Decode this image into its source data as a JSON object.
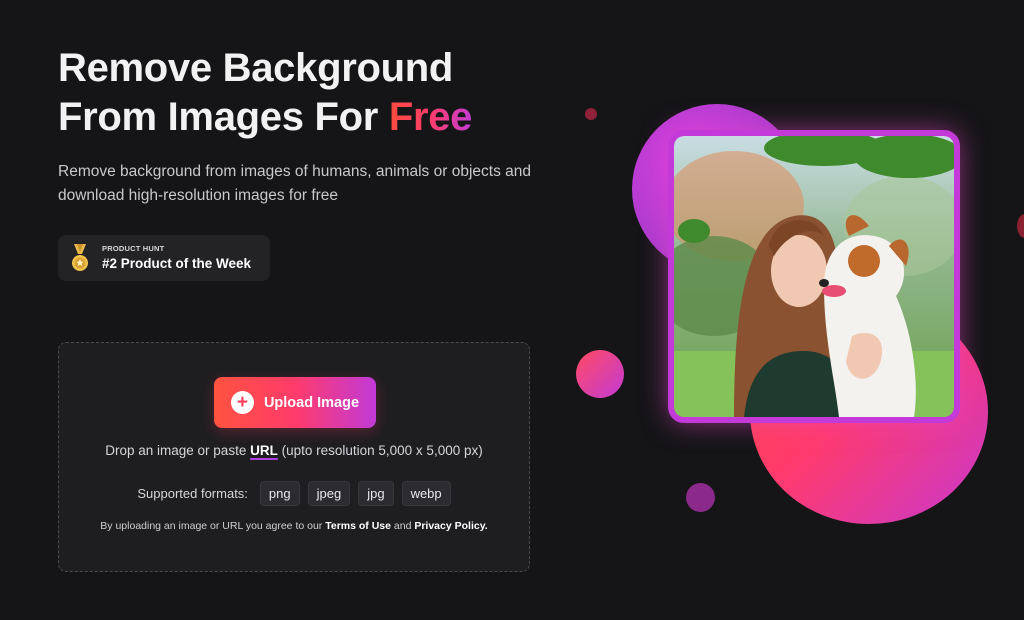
{
  "hero": {
    "title_line1": "Remove Background",
    "title_line2_prefix": "From Images For ",
    "title_highlight": "Free",
    "subtitle": "Remove background from images of humans, animals or objects and download high-resolution images for free"
  },
  "badge": {
    "small_label": "PRODUCT HUNT",
    "main_label": "#2 Product of the Week",
    "icon": "medal-icon"
  },
  "upload": {
    "button_label": "Upload Image",
    "drop_text_before": "Drop an image or paste ",
    "drop_link": "URL",
    "drop_text_after": " (upto resolution 5,000 x 5,000 px)",
    "formats_label": "Supported formats:",
    "formats": [
      "png",
      "jpeg",
      "jpg",
      "webp"
    ],
    "terms_prefix": "By uploading an image or URL you agree to our ",
    "terms_link": "Terms of Use",
    "terms_and": " and ",
    "privacy_link": "Privacy Policy."
  },
  "colors": {
    "background": "#151517",
    "accent_red": "#ff4b3e",
    "accent_pink": "#ff3b6b",
    "accent_purple": "#c13ad8"
  }
}
